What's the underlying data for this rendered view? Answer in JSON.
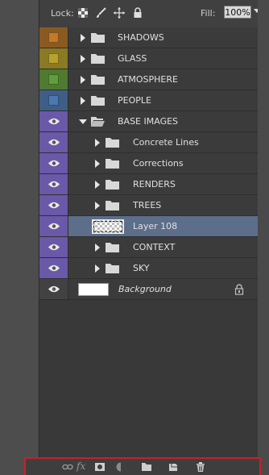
{
  "toolbar": {
    "lock_label": "Lock:",
    "lock_icons": [
      "transparency-lock-icon",
      "brush-icon",
      "move-icon",
      "padlock-icon"
    ],
    "fill_label": "Fill:",
    "fill_value": "100%"
  },
  "layers": [
    {
      "label": "SHADOWS",
      "type": "group",
      "expanded": false,
      "indent": 0,
      "color_tag": "#c27a28"
    },
    {
      "label": "GLASS",
      "type": "group",
      "expanded": false,
      "indent": 0,
      "color_tag": "#b8a22e"
    },
    {
      "label": "ATMOSPHERE",
      "type": "group",
      "expanded": false,
      "indent": 0,
      "color_tag": "#5f9e3a"
    },
    {
      "label": "PEOPLE",
      "type": "group",
      "expanded": false,
      "indent": 0,
      "color_tag": "#4b78b2"
    },
    {
      "label": "BASE IMAGES",
      "type": "group",
      "expanded": true,
      "indent": 0,
      "visible": true
    },
    {
      "label": "Concrete Lines",
      "type": "group",
      "expanded": false,
      "indent": 1,
      "visible": true
    },
    {
      "label": "Corrections",
      "type": "group",
      "expanded": false,
      "indent": 1,
      "visible": true
    },
    {
      "label": "RENDERS",
      "type": "group",
      "expanded": false,
      "indent": 1,
      "visible": true
    },
    {
      "label": "TREES",
      "type": "group",
      "expanded": false,
      "indent": 1,
      "visible": true
    },
    {
      "label": "Layer 108",
      "type": "layer",
      "selected": true,
      "indent": 1,
      "visible": true
    },
    {
      "label": "CONTEXT",
      "type": "group",
      "expanded": false,
      "indent": 1,
      "visible": true
    },
    {
      "label": "SKY",
      "type": "group",
      "expanded": false,
      "indent": 1,
      "visible": true
    },
    {
      "label": "Background",
      "type": "background",
      "indent": 0,
      "visible": true,
      "locked": true
    }
  ],
  "bottom_bar": {
    "icons": [
      "link-icon",
      "fx-icon",
      "mask-icon",
      "adjustment-icon",
      "new-group-icon",
      "new-layer-icon",
      "trash-icon"
    ],
    "fx_text": "fx",
    "highlight_color": "#c8202a"
  }
}
